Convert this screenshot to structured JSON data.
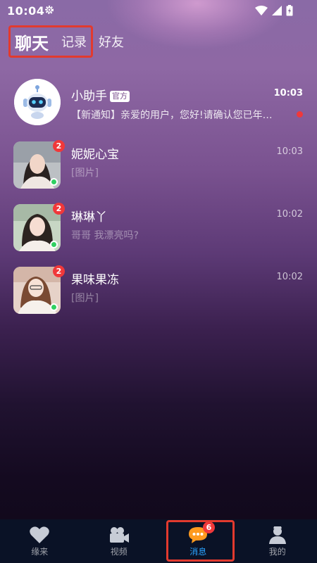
{
  "status_bar": {
    "time": "10:04"
  },
  "tabs": {
    "items": [
      {
        "label": "聊天",
        "active": true
      },
      {
        "label": "记录",
        "active": false
      },
      {
        "label": "好友",
        "active": false
      }
    ]
  },
  "chats": [
    {
      "name": "小助手",
      "tag": "官方",
      "time": "10:03",
      "preview": "【新通知】亲爱的用户，您好!请确认您已年…",
      "unread_dot": true
    },
    {
      "name": "妮妮心宝",
      "time": "10:03",
      "preview": "[图片]",
      "badge": "2",
      "online": true
    },
    {
      "name": "琳琳丫",
      "time": "10:02",
      "preview": "哥哥   我漂亮吗?",
      "badge": "2",
      "online": true
    },
    {
      "name": "果味果冻",
      "time": "10:02",
      "preview": "[图片]",
      "badge": "2",
      "online": true
    }
  ],
  "bottom_nav": {
    "items": [
      {
        "label": "缘来",
        "icon": "heart-icon"
      },
      {
        "label": "视频",
        "icon": "video-camera-icon"
      },
      {
        "label": "消息",
        "icon": "chat-bubble-icon",
        "badge": "6",
        "active": true
      },
      {
        "label": "我的",
        "icon": "profile-icon"
      }
    ]
  },
  "colors": {
    "accent_blue": "#2aa3ff",
    "badge_red": "#f0383a",
    "online_green": "#2fd061",
    "highlight_red": "#e23a2e",
    "nav_bg": "#0a1226"
  }
}
